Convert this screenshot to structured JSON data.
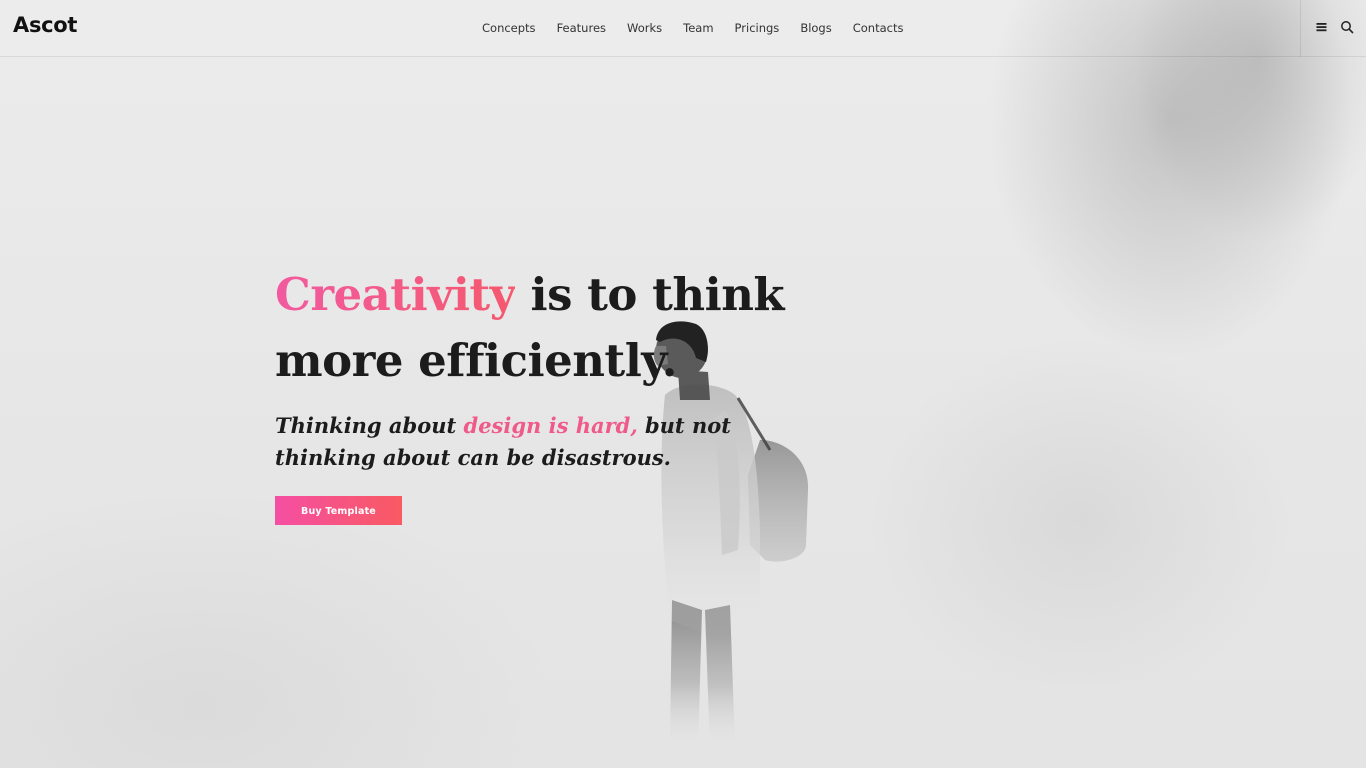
{
  "header": {
    "logo": "Ascot",
    "nav": [
      {
        "label": "Concepts"
      },
      {
        "label": "Features"
      },
      {
        "label": "Works"
      },
      {
        "label": "Team"
      },
      {
        "label": "Pricings"
      },
      {
        "label": "Blogs"
      },
      {
        "label": "Contacts"
      }
    ],
    "actions": {
      "menu_icon": "menu-icon",
      "search_icon": "search-icon"
    }
  },
  "hero": {
    "title_accent": "Creativity",
    "title_rest_line1": " is to think",
    "title_line2": "more efficiently.",
    "subtitle_start": "Thinking about ",
    "subtitle_accent": "design is hard,",
    "subtitle_end": " but not thinking about can be disastrous.",
    "cta_label": "Buy Template"
  },
  "colors": {
    "accent_pink": "#f25aa0",
    "accent_red": "#f95a62",
    "text_dark": "#1c1c1c",
    "background": "#e8e8e8"
  }
}
